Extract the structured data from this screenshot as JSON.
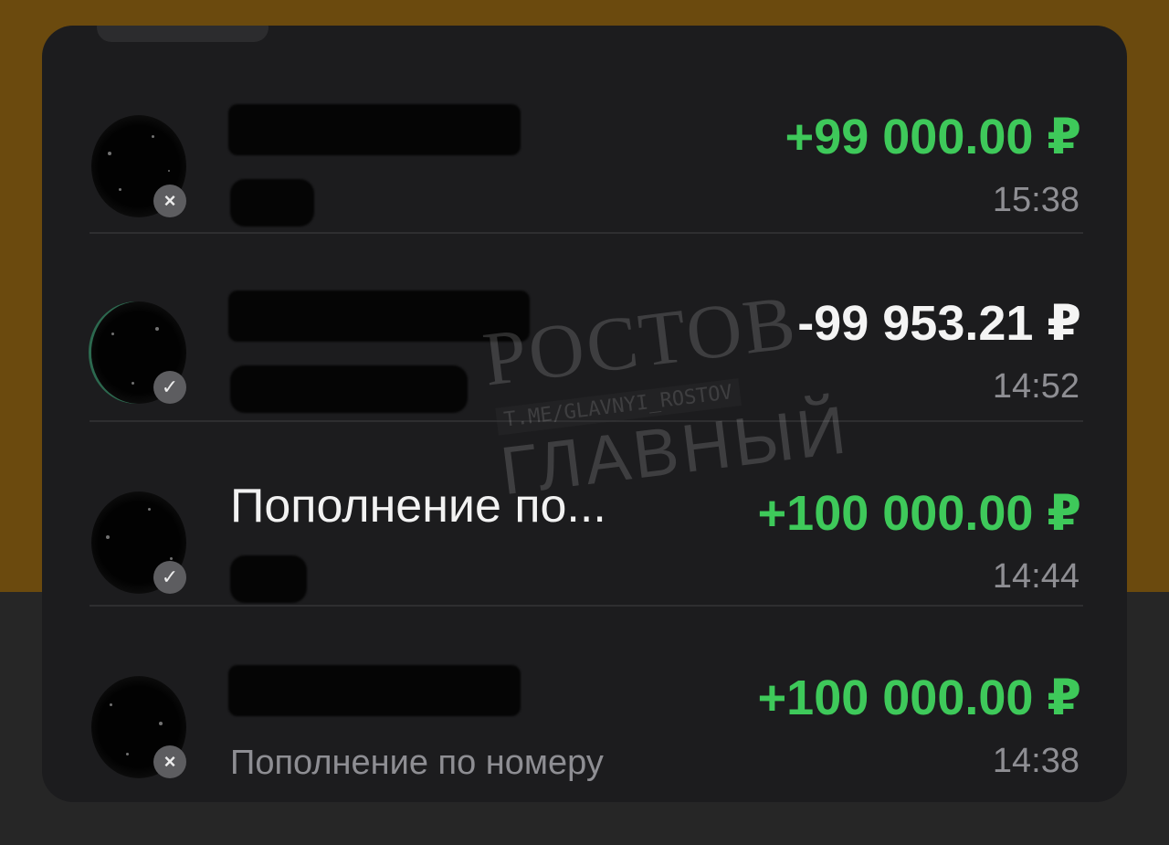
{
  "transactions": [
    {
      "title": "",
      "subtitle": "",
      "amount": "+99 000.00 ₽",
      "direction": "incoming",
      "time": "15:38",
      "status_icon": "close-icon"
    },
    {
      "title": "",
      "subtitle": "",
      "amount": "-99 953.21 ₽",
      "direction": "outgoing",
      "time": "14:52",
      "status_icon": "check-icon"
    },
    {
      "title": "Пополнение по...",
      "subtitle": "",
      "amount": "+100 000.00 ₽",
      "direction": "incoming",
      "time": "14:44",
      "status_icon": "check-icon"
    },
    {
      "title": "",
      "subtitle": "Пополнение по номеру",
      "amount": "+100 000.00 ₽",
      "direction": "incoming",
      "time": "14:38",
      "status_icon": "close-icon"
    }
  ],
  "watermark": {
    "top": "РОСТОВ",
    "middle": "T.ME/GLAVNYI_ROSTOV",
    "bottom": "ГЛАВНЫЙ"
  },
  "colors": {
    "positive_amount": "#3ec95a",
    "negative_amount": "#f4f4f4",
    "card_background": "#1c1c1e",
    "page_background_top": "#6b4a0e",
    "page_background_bottom": "#262626"
  }
}
